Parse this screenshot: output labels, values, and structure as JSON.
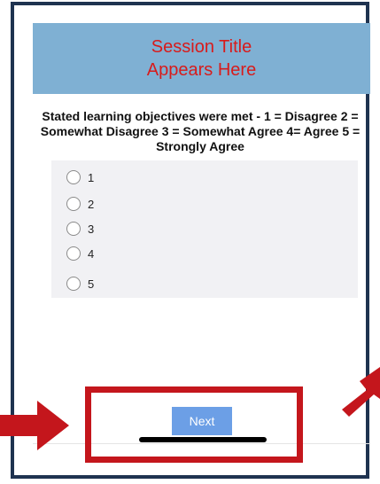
{
  "header": {
    "line1": "Session Title",
    "line2": "Appears Here"
  },
  "question": "Stated learning objectives were met - 1 = Disagree 2 = Somewhat Disagree 3 = Somewhat Agree 4= Agree 5 = Strongly Agree",
  "options": [
    "1",
    "2",
    "3",
    "4",
    "5"
  ],
  "next_label": "Next",
  "colors": {
    "header_bg": "#7fb0d3",
    "title": "#d81b1b",
    "highlight": "#c4161c",
    "button": "#6c9fe6",
    "frame": "#1f3350"
  }
}
